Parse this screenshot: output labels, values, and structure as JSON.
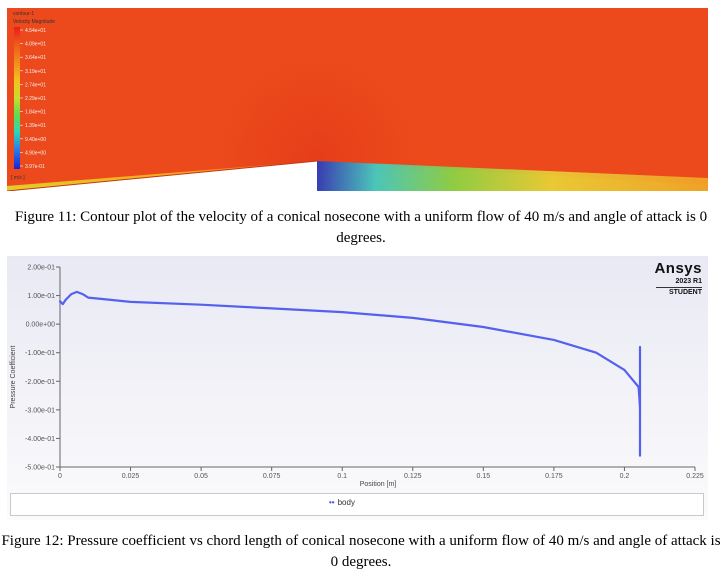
{
  "figure11": {
    "contour_title": "contour-1",
    "contour_subtitle": "Velocity Magnitude",
    "levels": [
      "4.54e+01",
      "4.09e+01",
      "3.64e+01",
      "3.19e+01",
      "2.74e+01",
      "2.29e+01",
      "1.84e+01",
      "1.39e+01",
      "9.40e+00",
      "4.90e+00",
      "3.97e-01"
    ],
    "unit": "[ m/s ]",
    "caption": "Figure 11: Contour plot of the velocity of a conical nosecone with a uniform flow of 40 m/s and angle of attack is 0 degrees."
  },
  "figure12": {
    "caption": "Figure 12: Pressure coefficient vs chord length of conical nosecone with a uniform flow of 40 m/s and angle of attack is 0 degrees.",
    "brand": "Ansys",
    "version": "2023 R1",
    "edition": "STUDENT",
    "legend_label": "body",
    "chart_data": {
      "type": "line",
      "xlabel": "Position [m]",
      "ylabel": "Pressure Coefficient",
      "xlim": [
        0,
        0.225
      ],
      "ylim": [
        -0.5,
        0.2
      ],
      "x_ticks": [
        0,
        0.025,
        0.05,
        0.075,
        0.1,
        0.125,
        0.15,
        0.175,
        0.2,
        0.225
      ],
      "x_tick_labels": [
        "0",
        "0.025",
        "0.05",
        "0.075",
        "0.1",
        "0.125",
        "0.15",
        "0.175",
        "0.2",
        "0.225"
      ],
      "y_ticks": [
        0.2,
        0.1,
        0,
        -0.1,
        -0.2,
        -0.3,
        -0.4,
        -0.5
      ],
      "y_tick_labels": [
        "2.00e-01",
        "1.00e-01",
        "0.00e+00",
        "-1.00e-01",
        "-2.00e-01",
        "-3.00e-01",
        "-4.00e-01",
        "-5.00e-01"
      ],
      "grid": false,
      "legend_position": "bottom",
      "series": [
        {
          "name": "body",
          "color": "#5560ee",
          "x": [
            0,
            0.001,
            0.002,
            0.004,
            0.006,
            0.008,
            0.01,
            0.015,
            0.025,
            0.05,
            0.075,
            0.1,
            0.125,
            0.15,
            0.175,
            0.19,
            0.2,
            0.205,
            0.2055
          ],
          "y": [
            0.08,
            0.07,
            0.085,
            0.105,
            0.113,
            0.105,
            0.093,
            0.088,
            0.078,
            0.068,
            0.055,
            0.042,
            0.022,
            -0.01,
            -0.055,
            -0.1,
            -0.16,
            -0.22,
            -0.29
          ]
        },
        {
          "name": "",
          "color": "#5560ee",
          "x": [
            0.2055,
            0.2055
          ],
          "y": [
            -0.08,
            -0.46
          ]
        }
      ]
    }
  }
}
